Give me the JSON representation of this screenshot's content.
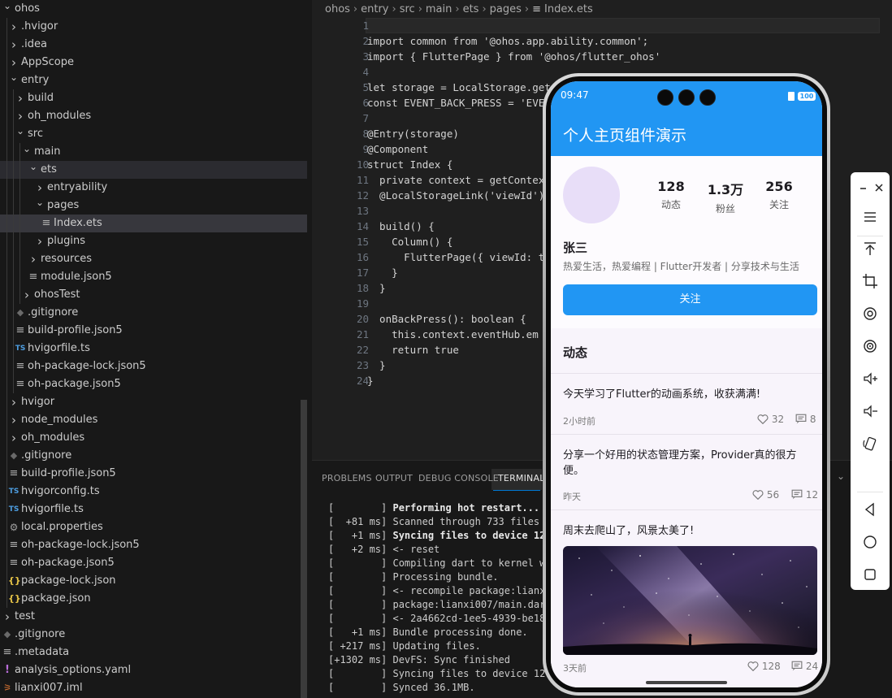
{
  "explorer": {
    "items": [
      {
        "label": "ohos",
        "depth": 0,
        "type": "folder-open"
      },
      {
        "label": ".hvigor",
        "depth": 1,
        "type": "folder"
      },
      {
        "label": ".idea",
        "depth": 1,
        "type": "folder"
      },
      {
        "label": "AppScope",
        "depth": 1,
        "type": "folder"
      },
      {
        "label": "entry",
        "depth": 1,
        "type": "folder-open"
      },
      {
        "label": "build",
        "depth": 2,
        "type": "folder"
      },
      {
        "label": "oh_modules",
        "depth": 2,
        "type": "folder"
      },
      {
        "label": "src",
        "depth": 2,
        "type": "folder-open"
      },
      {
        "label": "main",
        "depth": 3,
        "type": "folder-open"
      },
      {
        "label": "ets",
        "depth": 4,
        "type": "folder-open",
        "state": "active"
      },
      {
        "label": "entryability",
        "depth": 5,
        "type": "folder"
      },
      {
        "label": "pages",
        "depth": 5,
        "type": "folder-open"
      },
      {
        "label": "Index.ets",
        "depth": 6,
        "type": "lines",
        "state": "selected"
      },
      {
        "label": "plugins",
        "depth": 5,
        "type": "folder"
      },
      {
        "label": "resources",
        "depth": 4,
        "type": "folder"
      },
      {
        "label": "module.json5",
        "depth": 4,
        "type": "lines"
      },
      {
        "label": "ohosTest",
        "depth": 3,
        "type": "folder"
      },
      {
        "label": ".gitignore",
        "depth": 2,
        "type": "git"
      },
      {
        "label": "build-profile.json5",
        "depth": 2,
        "type": "lines"
      },
      {
        "label": "hvigorfile.ts",
        "depth": 2,
        "type": "ts"
      },
      {
        "label": "oh-package-lock.json5",
        "depth": 2,
        "type": "lines"
      },
      {
        "label": "oh-package.json5",
        "depth": 2,
        "type": "lines"
      },
      {
        "label": "hvigor",
        "depth": 1,
        "type": "folder"
      },
      {
        "label": "node_modules",
        "depth": 1,
        "type": "folder"
      },
      {
        "label": "oh_modules",
        "depth": 1,
        "type": "folder"
      },
      {
        "label": ".gitignore",
        "depth": 1,
        "type": "git"
      },
      {
        "label": "build-profile.json5",
        "depth": 1,
        "type": "lines"
      },
      {
        "label": "hvigorconfig.ts",
        "depth": 1,
        "type": "ts"
      },
      {
        "label": "hvigorfile.ts",
        "depth": 1,
        "type": "ts"
      },
      {
        "label": "local.properties",
        "depth": 1,
        "type": "gear"
      },
      {
        "label": "oh-package-lock.json5",
        "depth": 1,
        "type": "lines"
      },
      {
        "label": "oh-package.json5",
        "depth": 1,
        "type": "lines"
      },
      {
        "label": "package-lock.json",
        "depth": 1,
        "type": "json"
      },
      {
        "label": "package.json",
        "depth": 1,
        "type": "json"
      },
      {
        "label": "test",
        "depth": 0,
        "type": "folder"
      },
      {
        "label": ".gitignore",
        "depth": 0,
        "type": "git"
      },
      {
        "label": ".metadata",
        "depth": 0,
        "type": "lines"
      },
      {
        "label": "analysis_options.yaml",
        "depth": 0,
        "type": "yaml"
      },
      {
        "label": "lianxi007.iml",
        "depth": 0,
        "type": "rss"
      }
    ]
  },
  "breadcrumb": [
    "ohos",
    "entry",
    "src",
    "main",
    "ets",
    "pages",
    "Index.ets"
  ],
  "editor": {
    "lines": [
      {
        "n": "1",
        "text": ""
      },
      {
        "n": "2",
        "text": "import common from '@ohos.app.ability.common';"
      },
      {
        "n": "3",
        "text": "import { FlutterPage } from '@ohos/flutter_ohos'"
      },
      {
        "n": "4",
        "text": ""
      },
      {
        "n": "5",
        "text": "let storage = LocalStorage.get"
      },
      {
        "n": "6",
        "text": "const EVENT_BACK_PRESS = 'EVE"
      },
      {
        "n": "7",
        "text": ""
      },
      {
        "n": "8",
        "text": "@Entry(storage)"
      },
      {
        "n": "9",
        "text": "@Component"
      },
      {
        "n": "10",
        "text": "struct Index {"
      },
      {
        "n": "11",
        "text": "  private context = getContex"
      },
      {
        "n": "12",
        "text": "  @LocalStorageLink('viewId')"
      },
      {
        "n": "13",
        "text": ""
      },
      {
        "n": "14",
        "text": "  build() {"
      },
      {
        "n": "15",
        "text": "    Column() {"
      },
      {
        "n": "16",
        "text": "      FlutterPage({ viewId: t"
      },
      {
        "n": "17",
        "text": "    }"
      },
      {
        "n": "18",
        "text": "  }"
      },
      {
        "n": "19",
        "text": ""
      },
      {
        "n": "20",
        "text": "  onBackPress(): boolean {"
      },
      {
        "n": "21",
        "text": "    this.context.eventHub.em"
      },
      {
        "n": "22",
        "text": "    return true"
      },
      {
        "n": "23",
        "text": "  }"
      },
      {
        "n": "24",
        "text": "}"
      }
    ]
  },
  "panel": {
    "tabs": [
      "PROBLEMS",
      "OUTPUT",
      "DEBUG CONSOLE",
      "TERMINAL"
    ],
    "active_tab": "TERMINAL",
    "terminal": [
      {
        "prefix": "[        ] ",
        "text": "Performing hot restart...",
        "bold": true
      },
      {
        "prefix": "[  +81 ms] ",
        "text": "Scanned through 733 files i",
        "bold": false
      },
      {
        "prefix": "[   +1 ms] ",
        "text": "Syncing files to device 127",
        "bold": true
      },
      {
        "prefix": "[   +2 ms] ",
        "text": "<- reset",
        "bold": false
      },
      {
        "prefix": "[        ] ",
        "text": "Compiling dart to kernel wi",
        "bold": false
      },
      {
        "prefix": "[        ] ",
        "text": "Processing bundle.",
        "bold": false
      },
      {
        "prefix": "[        ] ",
        "text": "<- recompile package:lianxi",
        "bold": false
      },
      {
        "prefix": "[        ] ",
        "text": "package:lianxi007/main.dart",
        "bold": false
      },
      {
        "prefix": "[        ] ",
        "text": "<- 2a4662cd-1ee5-4939-be18-",
        "bold": false
      },
      {
        "prefix": "[   +1 ms] ",
        "text": "Bundle processing done.",
        "bold": false
      },
      {
        "prefix": "[ +217 ms] ",
        "text": "Updating files.",
        "bold": false
      },
      {
        "prefix": "[+1302 ms] ",
        "text": "DevFS: Sync finished",
        "bold": false
      },
      {
        "prefix": "[        ] ",
        "text": "Syncing files to device 127.",
        "bold": false
      },
      {
        "prefix": "[        ] ",
        "text": "Synced 36.1MB.",
        "bold": false
      }
    ]
  },
  "phone": {
    "status": {
      "time": "09:47",
      "battery": "100"
    },
    "app_title": "个人主页组件演示",
    "stats": [
      {
        "value": "128",
        "label": "动态"
      },
      {
        "value": "1.3万",
        "label": "粉丝"
      },
      {
        "value": "256",
        "label": "关注"
      }
    ],
    "user_name": "张三",
    "user_bio": "热爱生活，热爱编程 | Flutter开发者 | 分享技术与生活",
    "follow_label": "关注",
    "feed_title": "动态",
    "posts": [
      {
        "text": "今天学习了Flutter的动画系统，收获满满!",
        "time": "2小时前",
        "likes": "32",
        "comments": "8"
      },
      {
        "text": "分享一个好用的状态管理方案，Provider真的很方便。",
        "time": "昨天",
        "likes": "56",
        "comments": "12"
      },
      {
        "text": "周末去爬山了，风景太美了!",
        "time": "3天前",
        "likes": "128",
        "comments": "24"
      }
    ]
  },
  "emulator_toolbar": {
    "buttons": [
      "minimize-icon",
      "close-icon",
      "menu-icon",
      "top-icon",
      "crop-icon",
      "rotate-icon",
      "screenshot-icon",
      "volume-up-icon",
      "volume-down-icon",
      "shake-icon",
      "back-icon",
      "home-icon",
      "recent-icon"
    ]
  },
  "colors": {
    "accent": "#2196f3",
    "editor_bg": "#1f1f1f",
    "sidebar_bg": "#181818"
  }
}
